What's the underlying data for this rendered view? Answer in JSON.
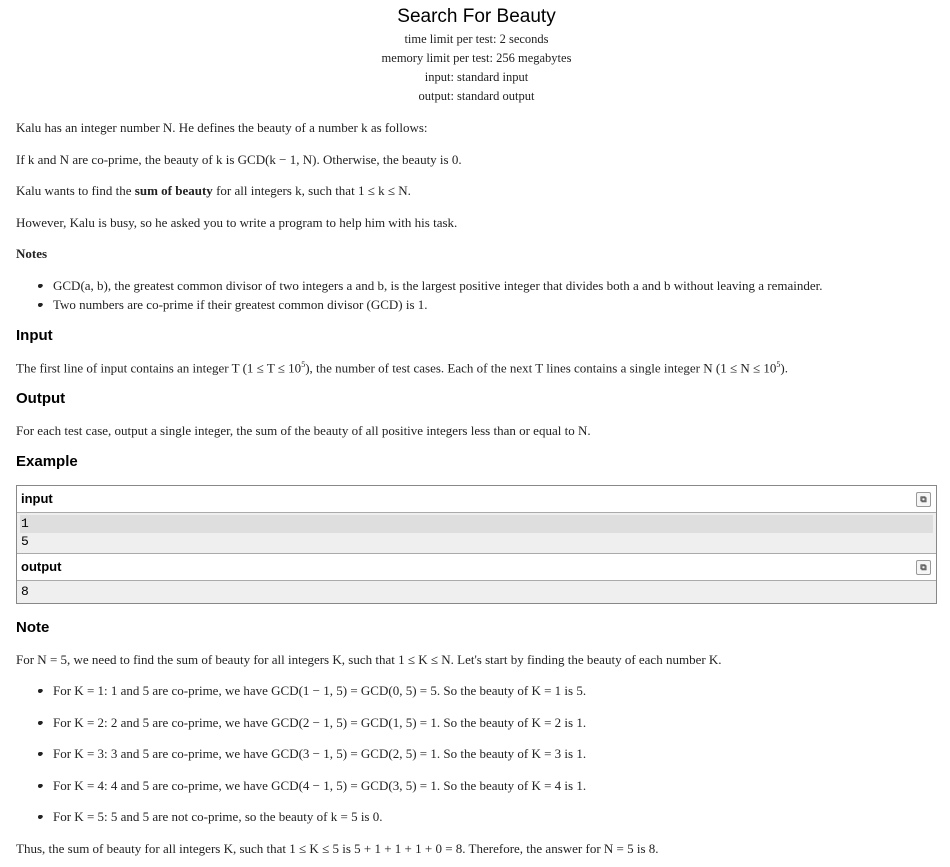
{
  "problem": {
    "title": "Search For Beauty",
    "time_limit": "time limit per test: 2 seconds",
    "memory_limit": "memory limit per test: 256 megabytes",
    "input_type": "input: standard input",
    "output_type": "output: standard output"
  },
  "statement": {
    "p1": "Kalu has an integer number N. He defines the beauty of a number k as follows:",
    "p2": "If k and N are co-prime, the beauty of k is GCD(k − 1, N). Otherwise, the beauty is 0.",
    "p3_a": "Kalu wants to find the ",
    "p3_bold": "sum of beauty",
    "p3_b": " for all integers k, such that 1 ≤ k ≤ N.",
    "p4": "However, Kalu is busy, so he asked you to write a program to help him with his task.",
    "notes_heading": "Notes",
    "notes": [
      "GCD(a, b), the greatest common divisor of two integers a and b, is the largest positive integer that divides both a and b without leaving a remainder.",
      "Two numbers are co-prime if their greatest common divisor (GCD) is 1."
    ]
  },
  "input_section": {
    "heading": "Input",
    "text_a": "The first line of input contains an integer T (1 ≤ T ≤ 10",
    "sup1": "5",
    "text_b": "), the number of test cases. Each of the next T lines contains a single integer N (1 ≤ N ≤ 10",
    "sup2": "5",
    "text_c": ")."
  },
  "output_section": {
    "heading": "Output",
    "text": "For each test case, output a single integer, the sum of the beauty of all positive integers less than or equal to N."
  },
  "example": {
    "heading": "Example",
    "input_label": "input",
    "input_lines": [
      "1",
      "5"
    ],
    "output_label": "output",
    "output_lines": [
      "8"
    ]
  },
  "note": {
    "heading": "Note",
    "intro": "For N = 5, we need to find the sum of beauty for all integers K, such that 1 ≤ K ≤ N. Let's start by finding the beauty of each number K.",
    "items": [
      "For K = 1: 1 and 5 are co-prime, we have GCD(1 − 1, 5) = GCD(0, 5) = 5. So the beauty of K = 1 is 5.",
      "For K = 2: 2 and 5 are co-prime, we have GCD(2 − 1, 5) = GCD(1, 5) = 1. So the beauty of K = 2 is 1.",
      "For K = 3: 3 and 5 are co-prime, we have GCD(3 − 1, 5) = GCD(2, 5) = 1. So the beauty of K = 3 is 1.",
      "For K = 4: 4 and 5 are co-prime, we have GCD(4 − 1, 5) = GCD(3, 5) = 1. So the beauty of K = 4 is 1.",
      "For K = 5: 5 and 5 are not co-prime, so the beauty of k = 5 is 0."
    ],
    "conclusion": "Thus, the sum of beauty for all integers K, such that 1 ≤ K ≤ 5 is 5 + 1 + 1 + 1 + 0 = 8. Therefore, the answer for N = 5 is 8."
  },
  "icons": {
    "copy": "copy-icon"
  }
}
